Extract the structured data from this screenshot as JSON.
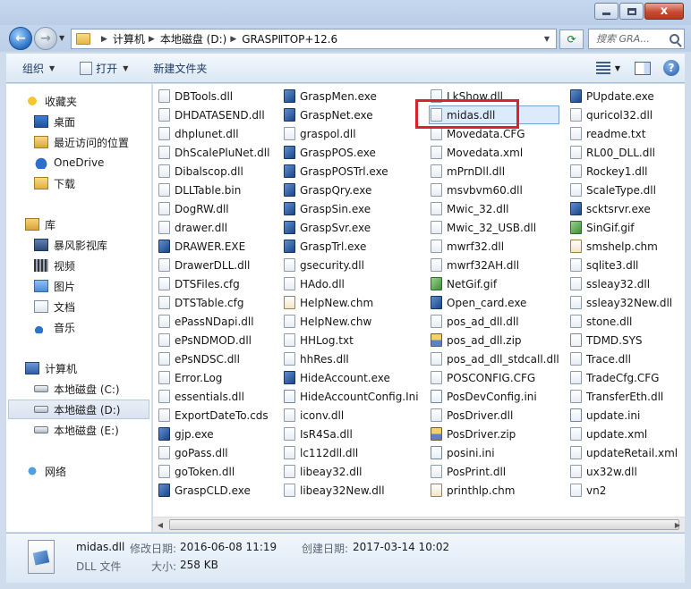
{
  "window": {
    "close_label": "x",
    "maximize_label": "",
    "minimize_label": ""
  },
  "address": {
    "crumbs": [
      "计算机",
      "本地磁盘 (D:)",
      "GRASPⅡTOP+12.6"
    ],
    "search_placeholder": "搜索 GRA..."
  },
  "toolbar": {
    "organize": "组织",
    "open": "打开",
    "new_folder": "新建文件夹",
    "help": "?"
  },
  "nav": {
    "favorites": "收藏夹",
    "desktop": "桌面",
    "recent": "最近访问的位置",
    "onedrive": "OneDrive",
    "downloads": "下载",
    "libraries": "库",
    "videos_lib": "暴风影视库",
    "video": "视频",
    "pictures": "图片",
    "documents": "文档",
    "music": "音乐",
    "computer": "计算机",
    "drive_c": "本地磁盘 (C:)",
    "drive_d": "本地磁盘 (D:)",
    "drive_e": "本地磁盘 (E:)",
    "network": "网络"
  },
  "files": {
    "col1": [
      {
        "name": "DBTools.dll",
        "type": "dll"
      },
      {
        "name": "DHDATASEND.dll",
        "type": "dll"
      },
      {
        "name": "dhplunet.dll",
        "type": "dll"
      },
      {
        "name": "DhScalePluNet.dll",
        "type": "dll"
      },
      {
        "name": "Dibalscop.dll",
        "type": "dll"
      },
      {
        "name": "DLLTable.bin",
        "type": "bin"
      },
      {
        "name": "DogRW.dll",
        "type": "dll"
      },
      {
        "name": "drawer.dll",
        "type": "dll"
      },
      {
        "name": "DRAWER.EXE",
        "type": "exe"
      },
      {
        "name": "DrawerDLL.dll",
        "type": "dll"
      },
      {
        "name": "DTSFiles.cfg",
        "type": "cfg"
      },
      {
        "name": "DTSTable.cfg",
        "type": "cfg"
      },
      {
        "name": "ePassNDapi.dll",
        "type": "dll"
      },
      {
        "name": "ePsNDMOD.dll",
        "type": "dll"
      },
      {
        "name": "ePsNDSC.dll",
        "type": "dll"
      },
      {
        "name": "Error.Log",
        "type": "log"
      },
      {
        "name": "essentials.dll",
        "type": "dll"
      },
      {
        "name": "ExportDateTo.cds",
        "type": "cds"
      },
      {
        "name": "gjp.exe",
        "type": "exe"
      },
      {
        "name": "goPass.dll",
        "type": "dll"
      },
      {
        "name": "goToken.dll",
        "type": "dll"
      },
      {
        "name": "GraspCLD.exe",
        "type": "exe"
      }
    ],
    "col2": [
      {
        "name": "GraspMen.exe",
        "type": "exe"
      },
      {
        "name": "GraspNet.exe",
        "type": "exe"
      },
      {
        "name": "graspol.dll",
        "type": "dll"
      },
      {
        "name": "GraspPOS.exe",
        "type": "exe"
      },
      {
        "name": "GraspPOSTrl.exe",
        "type": "exe"
      },
      {
        "name": "GraspQry.exe",
        "type": "exe"
      },
      {
        "name": "GraspSin.exe",
        "type": "exe"
      },
      {
        "name": "GraspSvr.exe",
        "type": "exe"
      },
      {
        "name": "GraspTrl.exe",
        "type": "exe"
      },
      {
        "name": "gsecurity.dll",
        "type": "dll"
      },
      {
        "name": "HAdo.dll",
        "type": "dll"
      },
      {
        "name": "HelpNew.chm",
        "type": "chm"
      },
      {
        "name": "HelpNew.chw",
        "type": "chw"
      },
      {
        "name": "HHLog.txt",
        "type": "txt"
      },
      {
        "name": "hhRes.dll",
        "type": "dll"
      },
      {
        "name": "HideAccount.exe",
        "type": "exe"
      },
      {
        "name": "HideAccountConfig.Ini",
        "type": "ini"
      },
      {
        "name": "iconv.dll",
        "type": "dll"
      },
      {
        "name": "IsR4Sa.dll",
        "type": "dll"
      },
      {
        "name": "lc112dll.dll",
        "type": "dll"
      },
      {
        "name": "libeay32.dll",
        "type": "dll"
      },
      {
        "name": "libeay32New.dll",
        "type": "dll"
      }
    ],
    "col3": [
      {
        "name": "LkShow.dll",
        "type": "dll"
      },
      {
        "name": "midas.dll",
        "type": "dll",
        "selected": true
      },
      {
        "name": "Movedata.CFG",
        "type": "cfg"
      },
      {
        "name": "Movedata.xml",
        "type": "xml"
      },
      {
        "name": "mPrnDll.dll",
        "type": "dll"
      },
      {
        "name": "msvbvm60.dll",
        "type": "dll"
      },
      {
        "name": "Mwic_32.dll",
        "type": "dll"
      },
      {
        "name": "Mwic_32_USB.dll",
        "type": "dll"
      },
      {
        "name": "mwrf32.dll",
        "type": "dll"
      },
      {
        "name": "mwrf32AH.dll",
        "type": "dll"
      },
      {
        "name": "NetGif.gif",
        "type": "gif"
      },
      {
        "name": "Open_card.exe",
        "type": "exe"
      },
      {
        "name": "pos_ad_dll.dll",
        "type": "dll"
      },
      {
        "name": "pos_ad_dll.zip",
        "type": "zip"
      },
      {
        "name": "pos_ad_dll_stdcall.dll",
        "type": "dll"
      },
      {
        "name": "POSCONFIG.CFG",
        "type": "cfg"
      },
      {
        "name": "PosDevConfig.ini",
        "type": "ini"
      },
      {
        "name": "PosDriver.dll",
        "type": "dll"
      },
      {
        "name": "PosDriver.zip",
        "type": "zip"
      },
      {
        "name": "posini.ini",
        "type": "ini"
      },
      {
        "name": "PosPrint.dll",
        "type": "dll"
      },
      {
        "name": "printhlp.chm",
        "type": "chm"
      }
    ],
    "col4": [
      {
        "name": "PUpdate.exe",
        "type": "exe"
      },
      {
        "name": "quricol32.dll",
        "type": "dll"
      },
      {
        "name": "readme.txt",
        "type": "txt"
      },
      {
        "name": "RL00_DLL.dll",
        "type": "dll"
      },
      {
        "name": "Rockey1.dll",
        "type": "dll"
      },
      {
        "name": "ScaleType.dll",
        "type": "dll"
      },
      {
        "name": "scktsrvr.exe",
        "type": "exe"
      },
      {
        "name": "SinGif.gif",
        "type": "gif"
      },
      {
        "name": "smshelp.chm",
        "type": "chm"
      },
      {
        "name": "sqlite3.dll",
        "type": "dll"
      },
      {
        "name": "ssleay32.dll",
        "type": "dll"
      },
      {
        "name": "ssleay32New.dll",
        "type": "dll"
      },
      {
        "name": "stone.dll",
        "type": "dll"
      },
      {
        "name": "TDMD.SYS",
        "type": "sys"
      },
      {
        "name": "Trace.dll",
        "type": "dll"
      },
      {
        "name": "TradeCfg.CFG",
        "type": "cfg"
      },
      {
        "name": "TransferEth.dll",
        "type": "dll"
      },
      {
        "name": "update.ini",
        "type": "ini"
      },
      {
        "name": "update.xml",
        "type": "xml"
      },
      {
        "name": "updateRetail.xml",
        "type": "xml"
      },
      {
        "name": "ux32w.dll",
        "type": "dll"
      },
      {
        "name": "vn2",
        "type": "file"
      }
    ]
  },
  "details": {
    "name": "midas.dll",
    "modified_label": "修改日期:",
    "modified_value": "2016-06-08 11:19",
    "created_label": "创建日期:",
    "created_value": "2017-03-14 10:02",
    "type": "DLL 文件",
    "size_label": "大小:",
    "size_value": "258 KB"
  },
  "colors": {
    "selection_border": "#7da2ce",
    "selection_fill": "#dcebfc",
    "callout_red": "#d8232a"
  }
}
